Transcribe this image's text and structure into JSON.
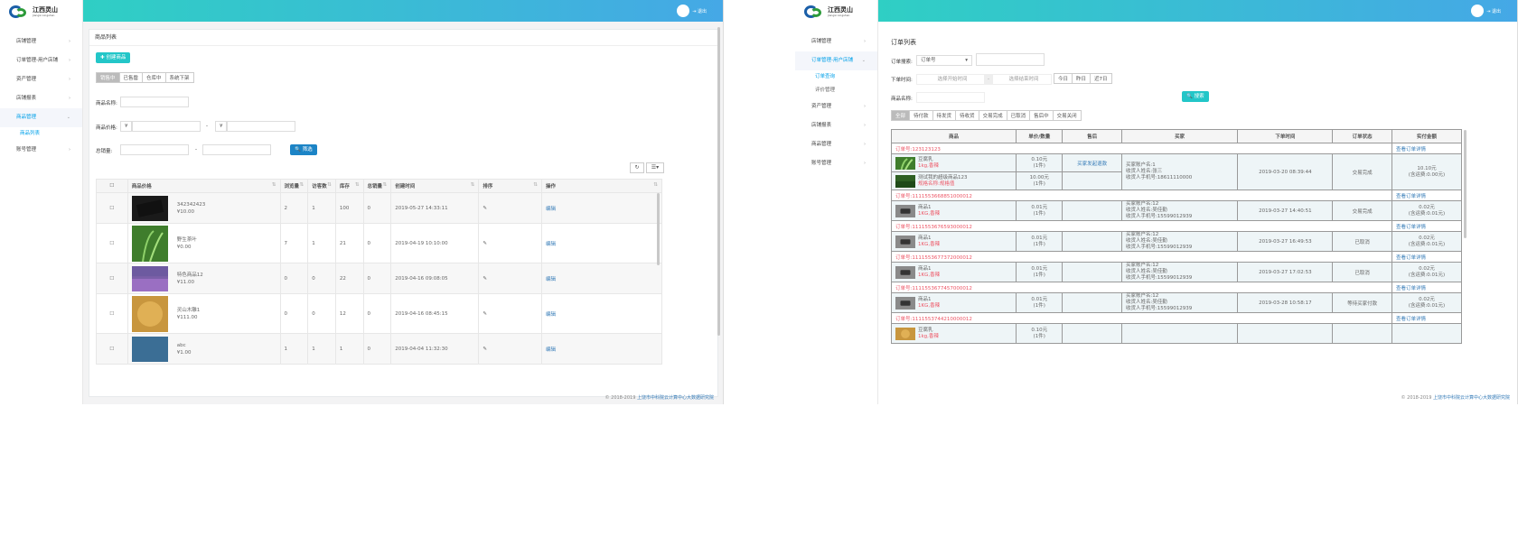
{
  "brand": {
    "name": "江西灵山",
    "sub": "Jiangxi Lingshan"
  },
  "user": {
    "logout": "退出"
  },
  "footer": {
    "prefix": "© 2018-2019 ",
    "org": "上饶市中科院云计算中心大数据研究院"
  },
  "colors": {
    "topbar_start": "#2fcfc4",
    "topbar_end": "#45a8e6",
    "accent": "#00a0e9",
    "price_red": "#ed5565"
  },
  "left": {
    "sidebar": [
      {
        "label": "店铺管理",
        "active": false
      },
      {
        "label": "订单管理-用户店铺",
        "active": false
      },
      {
        "label": "资产管理",
        "active": false
      },
      {
        "label": "店铺报表",
        "active": false
      },
      {
        "label": "商品管理",
        "active": true,
        "children": [
          "商品列表"
        ]
      },
      {
        "label": "账号管理",
        "active": false
      }
    ],
    "card_title": "商品列表",
    "create_button": "创建商品",
    "tabs": [
      "销售中",
      "已售罄",
      "仓库中",
      "系统下架"
    ],
    "active_tab": 0,
    "filters": {
      "name_label": "商品名称:",
      "price_label": "商品价格:",
      "currency": "¥",
      "dash": "-",
      "sales_label": "总销量:",
      "search_button": "筛选"
    },
    "table": {
      "headers": [
        "商品价格",
        "浏览量",
        "访客数",
        "库存",
        "总销量",
        "创建时间",
        "排序",
        "操作"
      ],
      "rows": [
        {
          "name": "342342423",
          "price": "¥10.00",
          "views": "2",
          "visitors": "1",
          "stock": "100",
          "sales": "0",
          "created": "2019-05-27 14:33:11",
          "action": "编辑",
          "img": "dark"
        },
        {
          "name": "野生茶叶",
          "price": "¥0.00",
          "views": "7",
          "visitors": "1",
          "stock": "21",
          "sales": "0",
          "created": "2019-04-19 10:10:00",
          "action": "编辑",
          "img": "green"
        },
        {
          "name": "特色商品12",
          "price": "¥11.00",
          "views": "0",
          "visitors": "0",
          "stock": "22",
          "sales": "0",
          "created": "2019-04-16 09:08:05",
          "action": "编辑",
          "img": "purple"
        },
        {
          "name": "灵山木雕1",
          "price": "¥111.00",
          "views": "0",
          "visitors": "0",
          "stock": "12",
          "sales": "0",
          "created": "2019-04-16 08:45:15",
          "action": "编辑",
          "img": "gold"
        },
        {
          "name": "abc",
          "price": "¥1.00",
          "views": "1",
          "visitors": "1",
          "stock": "1",
          "sales": "0",
          "created": "2019-04-04 11:32:30",
          "action": "编辑",
          "img": "blue"
        }
      ]
    }
  },
  "right": {
    "sidebar": [
      {
        "label": "店铺管理",
        "active": false
      },
      {
        "label": "订单管理-用户店铺",
        "active": true,
        "children": [
          "订单查询",
          "评价管理"
        ]
      },
      {
        "label": "资产管理",
        "active": false
      },
      {
        "label": "店铺报表",
        "active": false
      },
      {
        "label": "商品管理",
        "active": false
      },
      {
        "label": "账号管理",
        "active": false
      }
    ],
    "card_title": "订单列表",
    "filters": {
      "order_search_label": "订单搜索:",
      "order_select": "订单号",
      "time_label": "下单时间:",
      "start_placeholder": "选择开始时间",
      "end_placeholder": "选择结束时间",
      "quick": [
        "今日",
        "昨日",
        "近7日"
      ],
      "product_label": "商品名称:",
      "search_button": "搜索"
    },
    "tabs": [
      "全部",
      "待付款",
      "待发货",
      "待收货",
      "交易完成",
      "已取消",
      "售后中",
      "交易关闭"
    ],
    "active_tab": 0,
    "table": {
      "headers": [
        "商品",
        "单价/数量",
        "售后",
        "买家",
        "下单时间",
        "订单状态",
        "实付金额"
      ],
      "detail_link": "查看订单详情",
      "orders": [
        {
          "no": "订单号:123123123",
          "items": [
            {
              "name": "豆腐乳",
              "spec": "1kg,香辣",
              "price": "0.10元",
              "qty": "(1件)",
              "img": "green"
            },
            {
              "name": "测试我的超级商品123",
              "spec": "规格名称:规格值",
              "price": "10.00元",
              "qty": "(1件)",
              "img": "green2"
            }
          ],
          "aftersale": "买家发起退款",
          "buyer": [
            "买家账户名:1",
            "收货人姓名:张三",
            "收货人手机号:18611110000"
          ],
          "time": "2019-03-20 08:39:44",
          "status": "交易完成",
          "amount": "10.10元",
          "shipping": "(含运费:0.00元)"
        },
        {
          "no": "订单号:1111553668851000012",
          "items": [
            {
              "name": "商品1",
              "spec": "1KG,香辣",
              "price": "0.01元",
              "qty": "(1件)",
              "img": "gray"
            }
          ],
          "aftersale": "",
          "buyer": [
            "买家账户名:12",
            "收货人姓名:吴佳勤",
            "收货人手机号:15599012939"
          ],
          "time": "2019-03-27 14:40:51",
          "status": "交易完成",
          "amount": "0.02元",
          "shipping": "(含运费:0.01元)"
        },
        {
          "no": "订单号:1111553676593000012",
          "items": [
            {
              "name": "商品1",
              "spec": "1KG,香辣",
              "price": "0.01元",
              "qty": "(1件)",
              "img": "gray"
            }
          ],
          "aftersale": "",
          "buyer": [
            "买家账户名:12",
            "收货人姓名:吴佳勤",
            "收货人手机号:15599012939"
          ],
          "time": "2019-03-27 16:49:53",
          "status": "已取消",
          "amount": "0.02元",
          "shipping": "(含运费:0.01元)"
        },
        {
          "no": "订单号:1111553677372000012",
          "items": [
            {
              "name": "商品1",
              "spec": "1KG,香辣",
              "price": "0.01元",
              "qty": "(1件)",
              "img": "gray"
            }
          ],
          "aftersale": "",
          "buyer": [
            "买家账户名:12",
            "收货人姓名:吴佳勤",
            "收货人手机号:15599012939"
          ],
          "time": "2019-03-27 17:02:53",
          "status": "已取消",
          "amount": "0.02元",
          "shipping": "(含运费:0.01元)"
        },
        {
          "no": "订单号:1111553677457000012",
          "items": [
            {
              "name": "商品1",
              "spec": "1KG,香辣",
              "price": "0.01元",
              "qty": "(1件)",
              "img": "gray"
            }
          ],
          "aftersale": "",
          "buyer": [
            "买家账户名:12",
            "收货人姓名:吴佳勤",
            "收货人手机号:15599012939"
          ],
          "time": "2019-03-28 10:58:17",
          "status": "等待买家付款",
          "amount": "0.02元",
          "shipping": "(含运费:0.01元)"
        },
        {
          "no": "订单号:1111553744210000012",
          "items": [
            {
              "name": "豆腐乳",
              "spec": "1kg,香辣",
              "price": "0.10元",
              "qty": "(1件)",
              "img": "gold"
            }
          ],
          "aftersale": "",
          "buyer": [
            "",
            "",
            ""
          ],
          "time": "",
          "status": "",
          "amount": "",
          "shipping": ""
        }
      ]
    }
  }
}
